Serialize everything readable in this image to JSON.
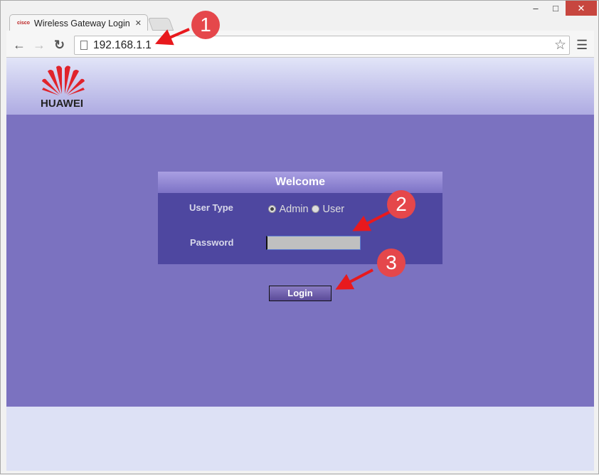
{
  "browser": {
    "tab_title": "Wireless Gateway Login",
    "tab_favicon": "cisco-icon",
    "url": "192.168.1.1",
    "minimize": "–",
    "maximize": "□",
    "close": "✕",
    "tab_close": "✕"
  },
  "page": {
    "logo_text": "HUAWEI",
    "panel_title": "Welcome",
    "user_type_label": "User Type",
    "options": [
      {
        "label": "Admin",
        "selected": true
      },
      {
        "label": "User",
        "selected": false
      }
    ],
    "password_label": "Password",
    "password_value": "",
    "login_label": "Login"
  },
  "annotations": [
    {
      "number": "1"
    },
    {
      "number": "2"
    },
    {
      "number": "3"
    }
  ],
  "colors": {
    "accent": "#7b72c0",
    "panel": "#4e47a0",
    "badge": "#e5474b",
    "logo": "#e0232b"
  }
}
